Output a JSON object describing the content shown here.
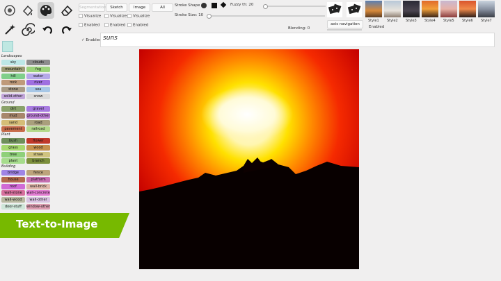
{
  "tools": {
    "row1": [
      "brush-circle-icon",
      "paint-bucket-icon",
      "palette-icon",
      "eraser-icon"
    ],
    "row2": [
      "magic-wand-icon",
      "spiral-icon",
      "undo-icon",
      "redo-icon"
    ]
  },
  "segmentation": {
    "landscapes": {
      "title": "Landscapes",
      "items": [
        {
          "label": "sky",
          "color": "#bde7e7"
        },
        {
          "label": "clouds",
          "color": "#8c8c8c"
        },
        {
          "label": "mountain",
          "color": "#9b9b73"
        },
        {
          "label": "fog",
          "color": "#9bd37b"
        },
        {
          "label": "hill",
          "color": "#7fcf8a"
        },
        {
          "label": "water",
          "color": "#b6a9e9"
        },
        {
          "label": "rock",
          "color": "#bf9a7a"
        },
        {
          "label": "river",
          "color": "#9f6fe0"
        },
        {
          "label": "stone",
          "color": "#a99b86"
        },
        {
          "label": "sea",
          "color": "#a7c7e6"
        },
        {
          "label": "solid-other",
          "color": "#c1a5d9"
        },
        {
          "label": "snow",
          "color": "#dadada"
        }
      ]
    },
    "ground": {
      "title": "Ground",
      "items": [
        {
          "label": "dirt",
          "color": "#8aa26a"
        },
        {
          "label": "gravel",
          "color": "#a77be0"
        },
        {
          "label": "mud",
          "color": "#a7866b"
        },
        {
          "label": "ground-other",
          "color": "#b77cd1"
        },
        {
          "label": "sand",
          "color": "#d5bd77"
        },
        {
          "label": "road",
          "color": "#a99f7c"
        },
        {
          "label": "pavement",
          "color": "#c76b4a"
        },
        {
          "label": "railroad",
          "color": "#b4d98a"
        }
      ]
    },
    "plant": {
      "title": "Plant",
      "items": [
        {
          "label": "bush",
          "color": "#6f8f5a"
        },
        {
          "label": "flower",
          "color": "#c0392b"
        },
        {
          "label": "grass",
          "color": "#a7d86e"
        },
        {
          "label": "wood",
          "color": "#c4914e"
        },
        {
          "label": "tree",
          "color": "#8fd07a"
        },
        {
          "label": "straw",
          "color": "#cfc37f"
        },
        {
          "label": "plant",
          "color": "#a6dc8c"
        },
        {
          "label": "branch",
          "color": "#7c8f3c"
        }
      ]
    },
    "building": {
      "title": "Building",
      "items": [
        {
          "label": "bridge",
          "color": "#9f84e6"
        },
        {
          "label": "fence",
          "color": "#bca37b"
        },
        {
          "label": "house",
          "color": "#b3694d"
        },
        {
          "label": "platform",
          "color": "#c66fb1"
        },
        {
          "label": "roof",
          "color": "#d06bd6"
        },
        {
          "label": "wall-brick",
          "color": "#e0b7ab"
        },
        {
          "label": "wall-stone",
          "color": "#d66f9d"
        },
        {
          "label": "wall-concrete",
          "color": "#e27bd2"
        },
        {
          "label": "wall-wood",
          "color": "#b8b8a0"
        },
        {
          "label": "wall-other",
          "color": "#d8c3e1"
        },
        {
          "label": "door-stuff",
          "color": "#cfe6d9"
        },
        {
          "label": "window-other",
          "color": "#dc9db1"
        }
      ]
    }
  },
  "toolbar": {
    "mode_buttons": [
      "Segmentation",
      "Sketch",
      "Image",
      "All"
    ],
    "visualize": [
      "Visualize",
      "Visualize",
      "Visualize"
    ],
    "enabled": [
      "Enabled",
      "Enabled",
      "Enabled"
    ],
    "prompt_enabled": "✓ Enabled",
    "stroke_shape_label": "Stroke Shape",
    "stroke_size_label": "Stroke Size: 10",
    "fuzzy_label": "Fuzzy th: 20",
    "blending_label": "Blending: 0",
    "axis_navigation": "axis navigation",
    "axis_enabled": "Enabled",
    "style_labels": [
      "Style1",
      "Style2",
      "Style3",
      "Style4",
      "Style5",
      "Style6",
      "Style7"
    ]
  },
  "prompt": {
    "value": "suns"
  },
  "banner": {
    "text": "Text-to-Image"
  },
  "colors": {
    "accent_green": "#77b900",
    "background": "#f0efef"
  }
}
